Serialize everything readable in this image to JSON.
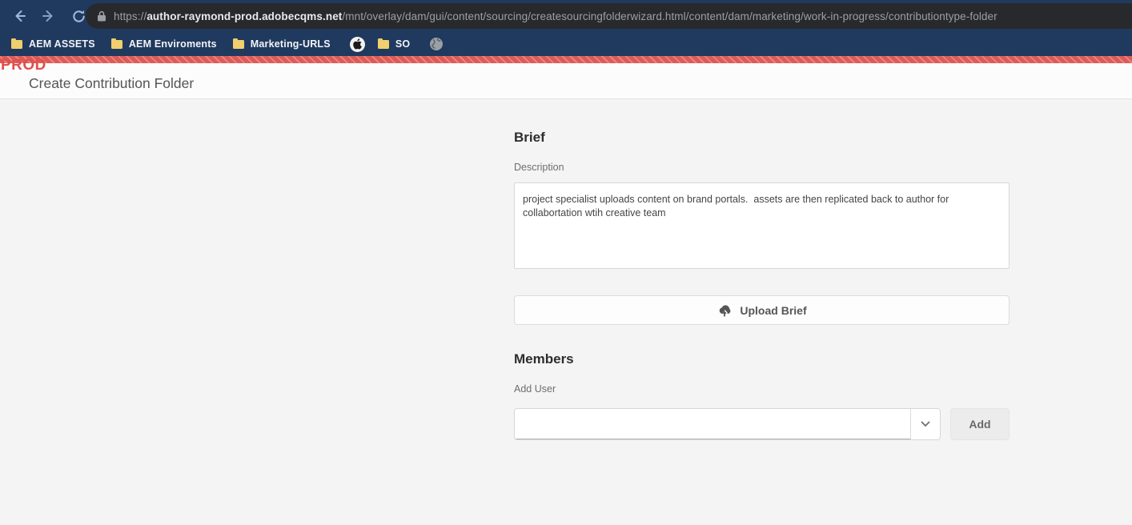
{
  "browser": {
    "url": {
      "scheme": "https://",
      "host": "author-raymond-prod.adobecqms.net",
      "path": "/mnt/overlay/dam/gui/content/sourcing/createsourcingfolderwizard.html/content/dam/marketing/work-in-progress/contributiontype-folder"
    },
    "bookmarks": [
      {
        "label": "AEM ASSETS",
        "icon": "folder"
      },
      {
        "label": "AEM Enviroments",
        "icon": "folder"
      },
      {
        "label": "Marketing-URLS",
        "icon": "folder"
      },
      {
        "label": "",
        "icon": "apple-favicon"
      },
      {
        "label": "SO",
        "icon": "folder"
      },
      {
        "label": "",
        "icon": "globe-favicon"
      }
    ]
  },
  "environment": {
    "badge": "PROD"
  },
  "page": {
    "title": "Create Contribution Folder"
  },
  "form": {
    "brief": {
      "heading": "Brief",
      "description_label": "Description",
      "description_value": "project specialist uploads content on brand portals.  assets are then replicated back to author for collabortation wtih creative team",
      "upload_button_label": "Upload Brief"
    },
    "members": {
      "heading": "Members",
      "add_user_label": "Add User",
      "add_user_value": "",
      "add_button_label": "Add"
    }
  },
  "colors": {
    "chrome_navy": "#20395e",
    "address_pill": "#28292c",
    "prod_red": "#e0504d",
    "band_red": "#dc5a57",
    "page_bg": "#f4f4f4",
    "header_bg": "#fcfcfc",
    "bookmark_folder_yellow": "#f0cf6e"
  }
}
